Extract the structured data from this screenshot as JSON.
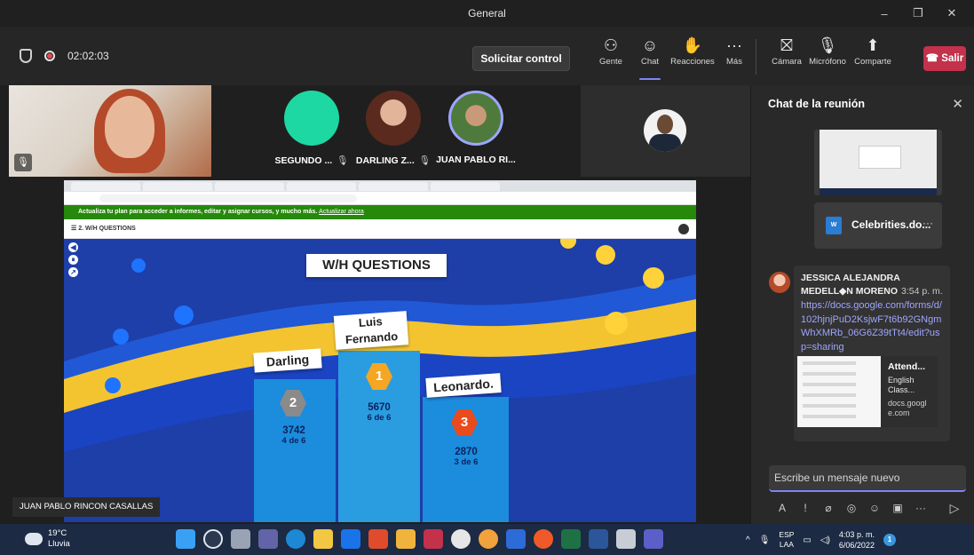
{
  "window": {
    "title": "General",
    "controls": [
      "–",
      "❐",
      "✕"
    ]
  },
  "toolbar": {
    "elapsed": "02:02:03",
    "request_control": "Solicitar control",
    "buttons": [
      {
        "label": "Gente",
        "icon": "people-icon"
      },
      {
        "label": "Chat",
        "icon": "chat-icon"
      },
      {
        "label": "Reacciones",
        "icon": "reactions-icon"
      },
      {
        "label": "Más",
        "icon": "more-icon"
      },
      {
        "label": "Cámara",
        "icon": "camera-off-icon"
      },
      {
        "label": "Micrófono",
        "icon": "mic-off-icon"
      },
      {
        "label": "Comparte",
        "icon": "share-icon"
      }
    ],
    "leave": "Salir",
    "accent": "#7f85f5",
    "leave_color": "#c4314b"
  },
  "participants": [
    {
      "name": "SEGUNDO ...",
      "avatar_color": "#1ed8a4"
    },
    {
      "name": "DARLING Z...",
      "avatar_color": "#7a3a2a"
    },
    {
      "name": "JUAN PABLO RI...",
      "avatar_color": "#4a6a3a"
    }
  ],
  "shared_screen": {
    "presenter": "JUAN PABLO RINCON CASALLAS",
    "upgrade_text": "Actualiza tu plan para acceder a informes, editar y asignar cursos, y mucho más.",
    "upgrade_link": "Actualizar ahora",
    "kahoot_header": "2. W/H QUESTIONS",
    "quiz_title": "W/H QUESTIONS",
    "podium": [
      {
        "rank": "1",
        "name": "Luis Fernando",
        "score": "5670",
        "correct": "6 de 6"
      },
      {
        "rank": "2",
        "name": "Darling",
        "score": "3742",
        "correct": "4 de 6"
      },
      {
        "rank": "3",
        "name": "Leonardo.",
        "score": "2870",
        "correct": "3 de 6"
      }
    ]
  },
  "chat": {
    "title": "Chat de la reunión",
    "file_name": "Celebrities.do...",
    "message": {
      "author": "JESSICA ALEJANDRA MEDELL◆N MORENO",
      "time": "3:54 p. m.",
      "link": "https://docs.google.com/forms/d/102hjnjPuD2KsjwF7t6b92GNgmWhXMRb_06G6Z39tTt4/edit?usp=sharing",
      "preview": {
        "title": "Attend...",
        "description": "English Class...",
        "site": "docs.google.com"
      }
    },
    "compose_placeholder": "Escribe un mensaje nuevo"
  },
  "taskbar": {
    "temperature": "19°C",
    "weather": "Lluvia",
    "lang_top": "ESP",
    "lang_bottom": "LAA",
    "time": "4:03 p. m.",
    "date": "6/06/2022",
    "notifications": "1"
  }
}
